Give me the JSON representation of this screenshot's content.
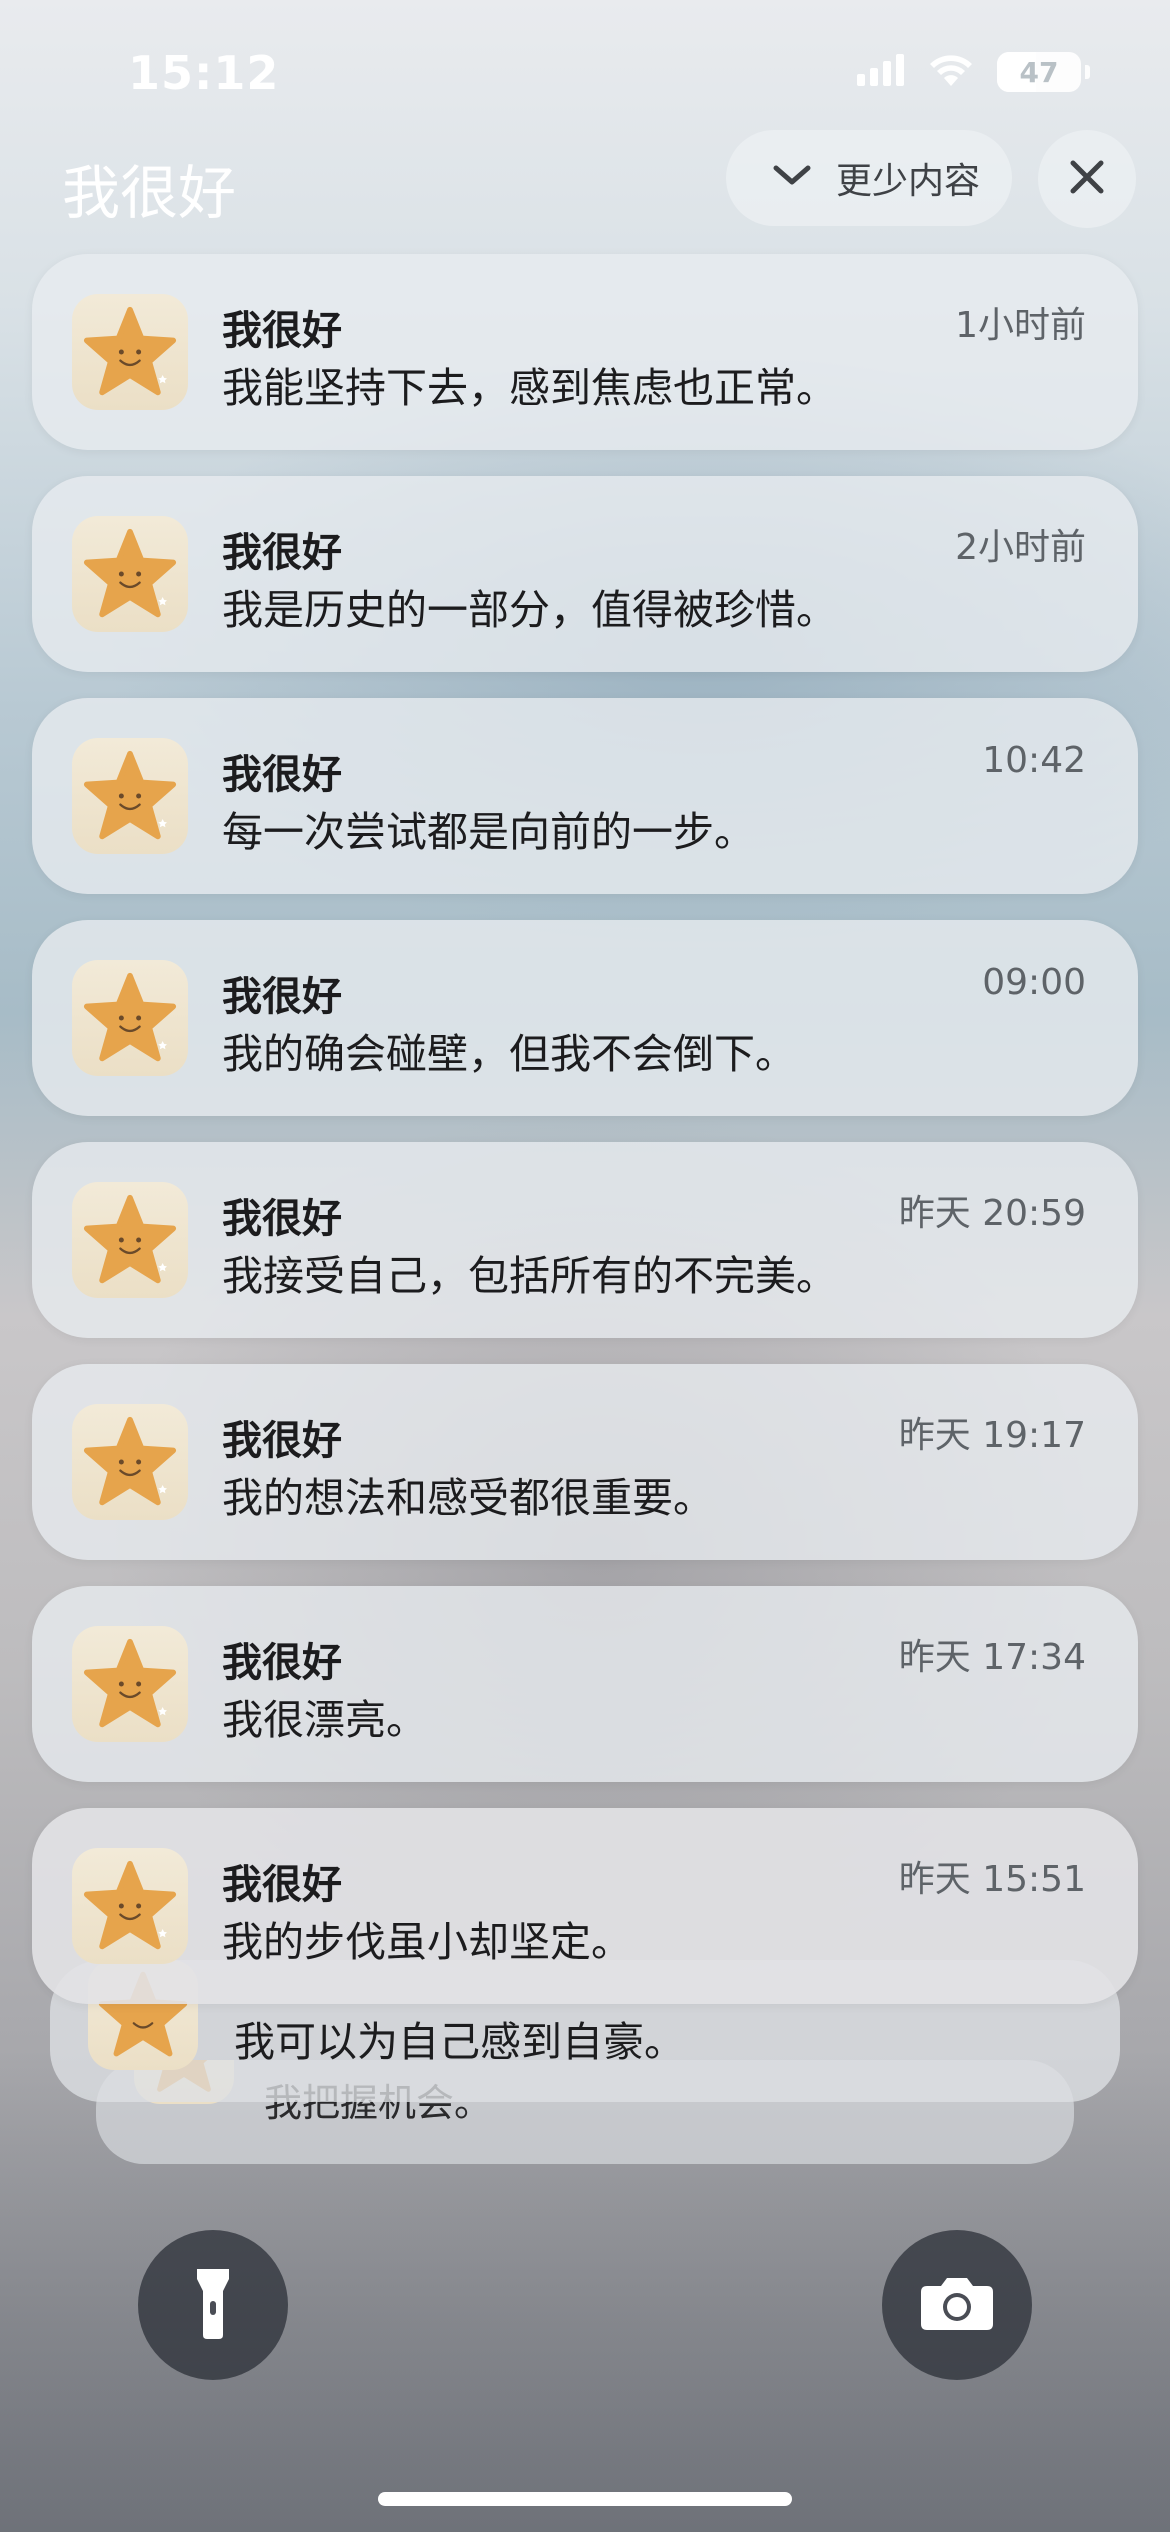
{
  "status": {
    "time": "15:12",
    "battery_level": "47",
    "icons": [
      "cellular-signal-icon",
      "wifi-icon",
      "battery-icon"
    ]
  },
  "header": {
    "group_title": "我很好",
    "show_less_label": "更少内容",
    "icons": [
      "chevron-down-icon",
      "close-icon"
    ]
  },
  "notifications": [
    {
      "app": "我很好",
      "time": "1小时前",
      "body": "我能坚持下去，感到焦虑也正常。"
    },
    {
      "app": "我很好",
      "time": "2小时前",
      "body": "我是历史的一部分，值得被珍惜。"
    },
    {
      "app": "我很好",
      "time": "10:42",
      "body": "每一次尝试都是向前的一步。"
    },
    {
      "app": "我很好",
      "time": "09:00",
      "body": "我的确会碰壁，但我不会倒下。"
    },
    {
      "app": "我很好",
      "time": "昨天 20:59",
      "body": "我接受自己，包括所有的不完美。"
    },
    {
      "app": "我很好",
      "time": "昨天 19:17",
      "body": "我的想法和感受都很重要。"
    },
    {
      "app": "我很好",
      "time": "昨天 17:34",
      "body": "我很漂亮。"
    },
    {
      "app": "我很好",
      "time": "昨天 15:51",
      "body": "我的步伐虽小却坚定。"
    }
  ],
  "stacked": [
    {
      "body": "我可以为自己感到自豪。"
    },
    {
      "body": "我把握机会。"
    }
  ],
  "bottom": {
    "icons": [
      "flashlight-icon",
      "camera-icon"
    ]
  },
  "colors": {
    "notification_bg": "#e8ecf0",
    "icon_star": "#e8a64c",
    "icon_bg": "#efe6d2"
  }
}
